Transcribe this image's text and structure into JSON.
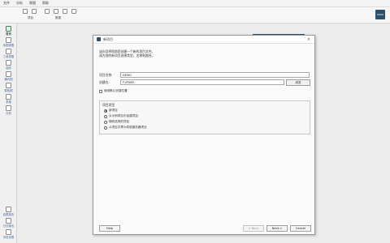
{
  "menubar": {
    "items": [
      "文件",
      "分析",
      "视图",
      "帮助"
    ]
  },
  "toolbar": {
    "groups": [
      {
        "label": "项目"
      },
      {
        "label": "数据"
      }
    ],
    "logo_text": "SPAD"
  },
  "sidebar": {
    "items": [
      {
        "label": "首页",
        "active": true
      },
      {
        "label": "地图视图",
        "active": false
      },
      {
        "label": "三维视图",
        "active": false
      },
      {
        "label": "曲线",
        "active": false
      },
      {
        "label": "横向图",
        "active": false
      },
      {
        "label": "模板图",
        "active": false
      },
      {
        "label": "表格",
        "active": false
      },
      {
        "label": "分析",
        "active": false
      },
      {
        "label": "结果报告",
        "active": false
      },
      {
        "label": "日志输出",
        "active": false
      },
      {
        "label": "系统设置",
        "active": false
      }
    ]
  },
  "dialog": {
    "title": "新项目",
    "description_line1": "该向导将帮助您创建一个新的项目文件。",
    "description_line2": "请为您的新项目选择类型，名称和路径。",
    "project_name_label": "项目名称:",
    "project_name_value": "DEMO",
    "create_in_label": "创建在:",
    "create_in_value": "F:\\PDMS",
    "browse_label": "浏览",
    "save_default_label": "使用默认创建位置",
    "project_type_title": "项目类型",
    "options": [
      {
        "label": "新项目",
        "checked": true
      },
      {
        "label": "从示例项目中创建项目",
        "checked": false
      },
      {
        "label": "随机选择的项目",
        "checked": false
      },
      {
        "label": "从项目共享为导航服务器项目",
        "checked": false
      }
    ],
    "buttons": {
      "help": "Help",
      "back": "< Back",
      "next": "Next >",
      "cancel": "Cancel"
    }
  }
}
